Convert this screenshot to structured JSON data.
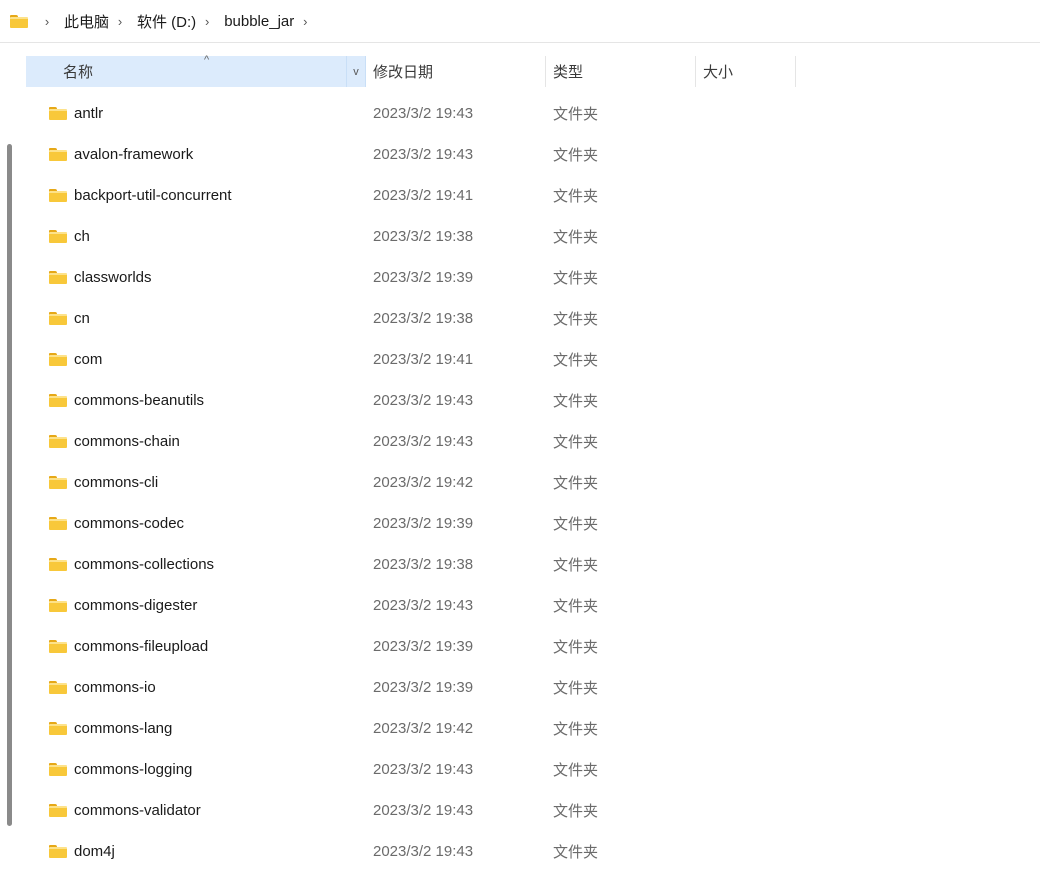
{
  "breadcrumb": {
    "icon": "folder-icon",
    "items": [
      "此电脑",
      "软件 (D:)",
      "bubble_jar"
    ],
    "separator": "›"
  },
  "columns": {
    "name": "名称",
    "date": "修改日期",
    "type": "类型",
    "size": "大小",
    "sort_indicator": "^",
    "dropdown": "v"
  },
  "rows": [
    {
      "name": "antlr",
      "date": "2023/3/2 19:43",
      "type": "文件夹"
    },
    {
      "name": "avalon-framework",
      "date": "2023/3/2 19:43",
      "type": "文件夹"
    },
    {
      "name": "backport-util-concurrent",
      "date": "2023/3/2 19:41",
      "type": "文件夹"
    },
    {
      "name": "ch",
      "date": "2023/3/2 19:38",
      "type": "文件夹"
    },
    {
      "name": "classworlds",
      "date": "2023/3/2 19:39",
      "type": "文件夹"
    },
    {
      "name": "cn",
      "date": "2023/3/2 19:38",
      "type": "文件夹"
    },
    {
      "name": "com",
      "date": "2023/3/2 19:41",
      "type": "文件夹"
    },
    {
      "name": "commons-beanutils",
      "date": "2023/3/2 19:43",
      "type": "文件夹"
    },
    {
      "name": "commons-chain",
      "date": "2023/3/2 19:43",
      "type": "文件夹"
    },
    {
      "name": "commons-cli",
      "date": "2023/3/2 19:42",
      "type": "文件夹"
    },
    {
      "name": "commons-codec",
      "date": "2023/3/2 19:39",
      "type": "文件夹"
    },
    {
      "name": "commons-collections",
      "date": "2023/3/2 19:38",
      "type": "文件夹"
    },
    {
      "name": "commons-digester",
      "date": "2023/3/2 19:43",
      "type": "文件夹"
    },
    {
      "name": "commons-fileupload",
      "date": "2023/3/2 19:39",
      "type": "文件夹"
    },
    {
      "name": "commons-io",
      "date": "2023/3/2 19:39",
      "type": "文件夹"
    },
    {
      "name": "commons-lang",
      "date": "2023/3/2 19:42",
      "type": "文件夹"
    },
    {
      "name": "commons-logging",
      "date": "2023/3/2 19:43",
      "type": "文件夹"
    },
    {
      "name": "commons-validator",
      "date": "2023/3/2 19:43",
      "type": "文件夹"
    },
    {
      "name": "dom4j",
      "date": "2023/3/2 19:43",
      "type": "文件夹"
    }
  ],
  "colors": {
    "header_selected": "#dcebfc",
    "folder": "#f8c83a",
    "secondary_text": "#6b6b6b"
  }
}
